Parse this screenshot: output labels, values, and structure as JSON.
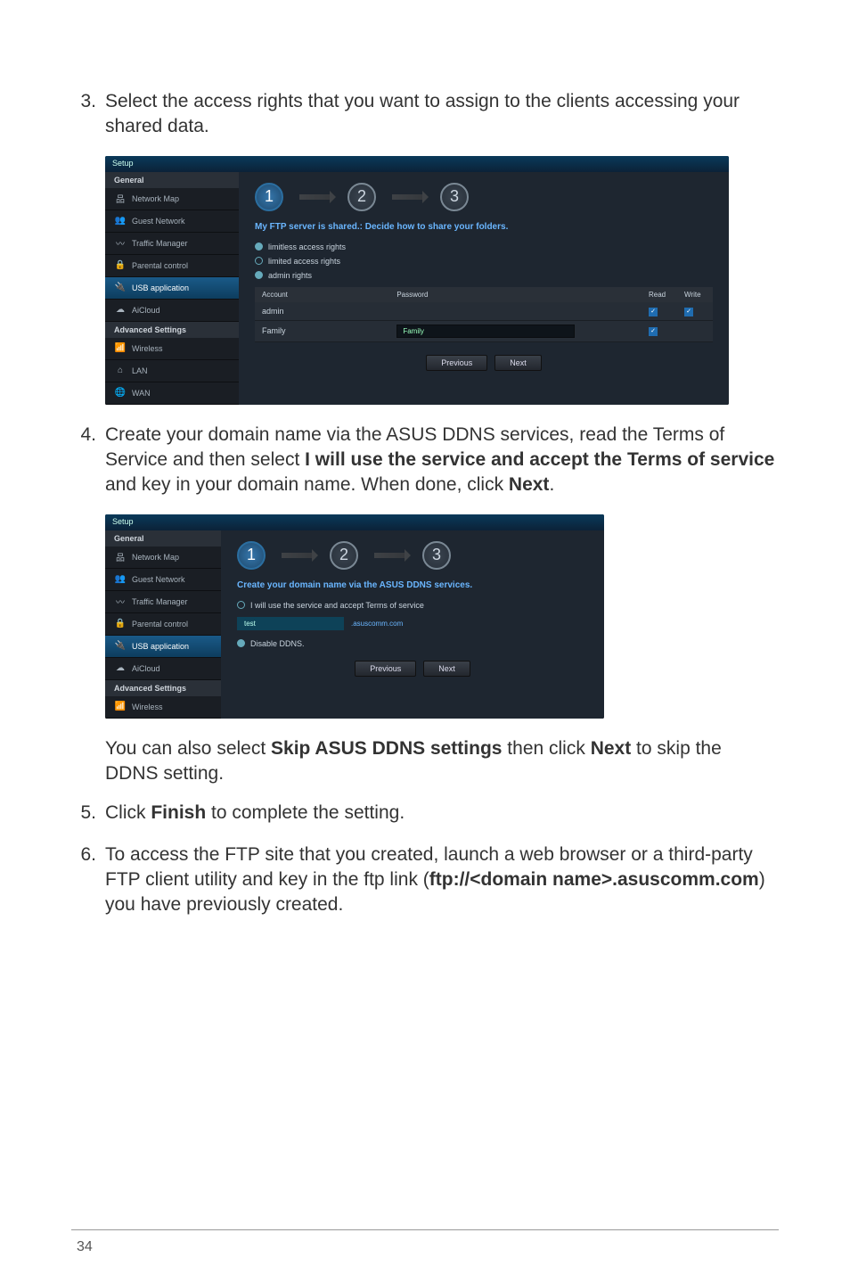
{
  "steps": {
    "s3": {
      "num": "3.",
      "text": "Select the access rights that you want to assign to the clients accessing your shared data."
    },
    "s4": {
      "num": "4.",
      "prefix": "Create your domain name via the ASUS DDNS services, read the Terms of Service and then select ",
      "bold1": "I will use the service and accept the Terms of service",
      "mid": " and key in your domain name. When done, click ",
      "bold2": "Next",
      "suffix": "."
    },
    "s4_note": {
      "p1": "You can also select ",
      "b1": "Skip ASUS DDNS settings",
      "p2": " then click ",
      "b2": "Next",
      "p3": " to skip the DDNS setting."
    },
    "s5": {
      "num": "5.",
      "p1": "Click ",
      "b1": "Finish",
      "p2": " to complete the setting."
    },
    "s6": {
      "num": "6.",
      "p1": "To access the FTP site that you created, launch a web browser or a third-party FTP client utility and key in the ftp link (",
      "b1": "ftp://<domain name>.asuscomm.com",
      "p2": ") you have previously created."
    }
  },
  "screenshot1": {
    "setup": "Setup",
    "general": "General",
    "sidebar": [
      "Network Map",
      "Guest Network",
      "Traffic Manager",
      "Parental control",
      "USB application",
      "AiCloud"
    ],
    "advanced": "Advanced Settings",
    "adv_items": [
      "Wireless",
      "LAN",
      "WAN"
    ],
    "heading": "My FTP server is shared.: Decide how to share your folders.",
    "radios": [
      "limitless access rights",
      "limited access rights",
      "admin rights"
    ],
    "table": {
      "headers": [
        "Account",
        "Password",
        "Read",
        "Write"
      ],
      "rows": [
        {
          "account": "admin",
          "password": "",
          "read": true,
          "write": true
        },
        {
          "account": "Family",
          "password": "Family",
          "read": true,
          "write": false
        }
      ]
    },
    "buttons": [
      "Previous",
      "Next"
    ],
    "step_nums": [
      "1",
      "2",
      "3"
    ]
  },
  "screenshot2": {
    "setup": "Setup",
    "general": "General",
    "sidebar": [
      "Network Map",
      "Guest Network",
      "Traffic Manager",
      "Parental control",
      "USB application",
      "AiCloud"
    ],
    "advanced": "Advanced Settings",
    "adv_items": [
      "Wireless"
    ],
    "heading": "Create your domain name via the ASUS DDNS services.",
    "radio": "I will use the service and accept Terms of service",
    "domain_value": "test",
    "domain_suffix": ".asuscomm.com",
    "disable": "Disable DDNS.",
    "buttons": [
      "Previous",
      "Next"
    ],
    "step_nums": [
      "1",
      "2",
      "3"
    ]
  },
  "page_number": "34",
  "icons": {
    "network_map": "品",
    "guest": "👥",
    "traffic": "〰",
    "parental": "🔒",
    "usb": "🔌",
    "cloud": "☁",
    "wireless": "📶",
    "lan": "⌂",
    "wan": "🌐"
  }
}
